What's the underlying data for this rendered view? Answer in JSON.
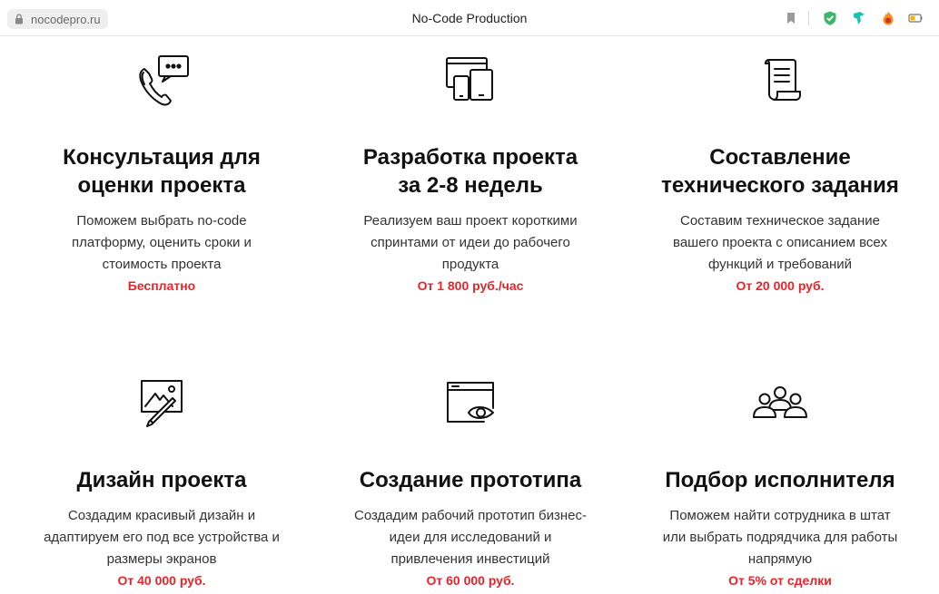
{
  "browser": {
    "url": "nocodepro.ru",
    "title": "No-Code Production",
    "icons": [
      "lock-icon",
      "bookmark-icon",
      "shield-check-icon",
      "extension-icon",
      "fire-extension-icon",
      "battery-icon"
    ]
  },
  "colors": {
    "accent": "#e8232a",
    "heading": "#111111",
    "text": "#333333"
  },
  "services": [
    {
      "icon": "phone-chat-icon",
      "title_line1": "Консультация для",
      "title_line2": "оценки проекта",
      "desc_line1": "Поможем выбрать no-code",
      "desc_line2": "платформу, оценить сроки и",
      "desc_line3": "стоимость проекта",
      "price": "Бесплатно"
    },
    {
      "icon": "devices-icon",
      "title_line1": "Разработка проекта",
      "title_line2": "за 2-8 недель",
      "desc_line1": "Реализуем ваш проект короткими",
      "desc_line2": "спринтами от идеи до рабочего",
      "desc_line3": "продукта",
      "price": "От 1 800 руб./час"
    },
    {
      "icon": "scroll-document-icon",
      "title_line1": "Составление",
      "title_line2": "технического задания",
      "desc_line1": "Составим техническое задание",
      "desc_line2": "вашего проекта с описанием всех",
      "desc_line3": "функций и требований",
      "price": "От 20 000 руб."
    },
    {
      "icon": "design-picture-icon",
      "title_line1": "Дизайн проекта",
      "desc_line1": "Создадим красивый дизайн и",
      "desc_line2": "адаптируем его под все устройства и",
      "desc_line3": "размеры экранов",
      "price": "От 40 000 руб."
    },
    {
      "icon": "browser-eye-icon",
      "title_line1": "Создание прототипа",
      "desc_line1": "Создадим рабочий прототип бизнес-",
      "desc_line2": "идеи для исследований и",
      "desc_line3": "привлечения инвестиций",
      "price": "От 60 000 руб."
    },
    {
      "icon": "team-people-icon",
      "title_line1": "Подбор исполнителя",
      "desc_line1": "Поможем найти сотрудника в штат",
      "desc_line2": "или выбрать подрядчика для работы",
      "desc_line3": "напрямую",
      "price": "От 5% от сделки"
    }
  ]
}
